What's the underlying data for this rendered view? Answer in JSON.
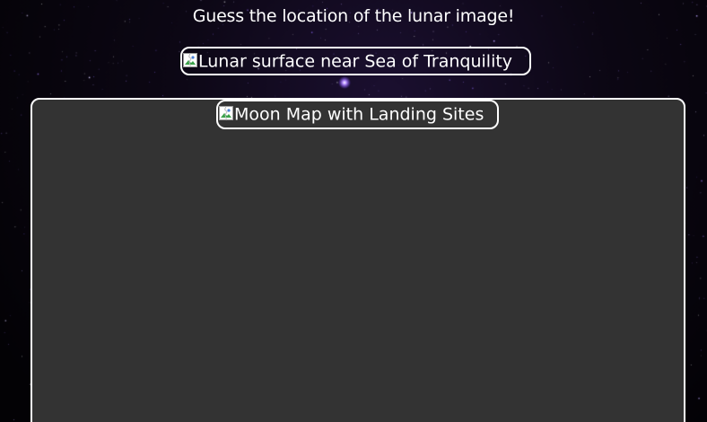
{
  "prompt": {
    "title": "Guess the location of the lunar image!"
  },
  "lunar_image": {
    "alt": "Lunar surface near Sea of Tranquility",
    "icon": "broken-image-icon"
  },
  "map": {
    "alt": "Moon Map with Landing Sites",
    "icon": "broken-image-icon"
  },
  "colors": {
    "background": "#050308",
    "panel": "#333333",
    "border": "#ffffff",
    "text": "#ffffff",
    "star_accent": "#9b6cff"
  }
}
